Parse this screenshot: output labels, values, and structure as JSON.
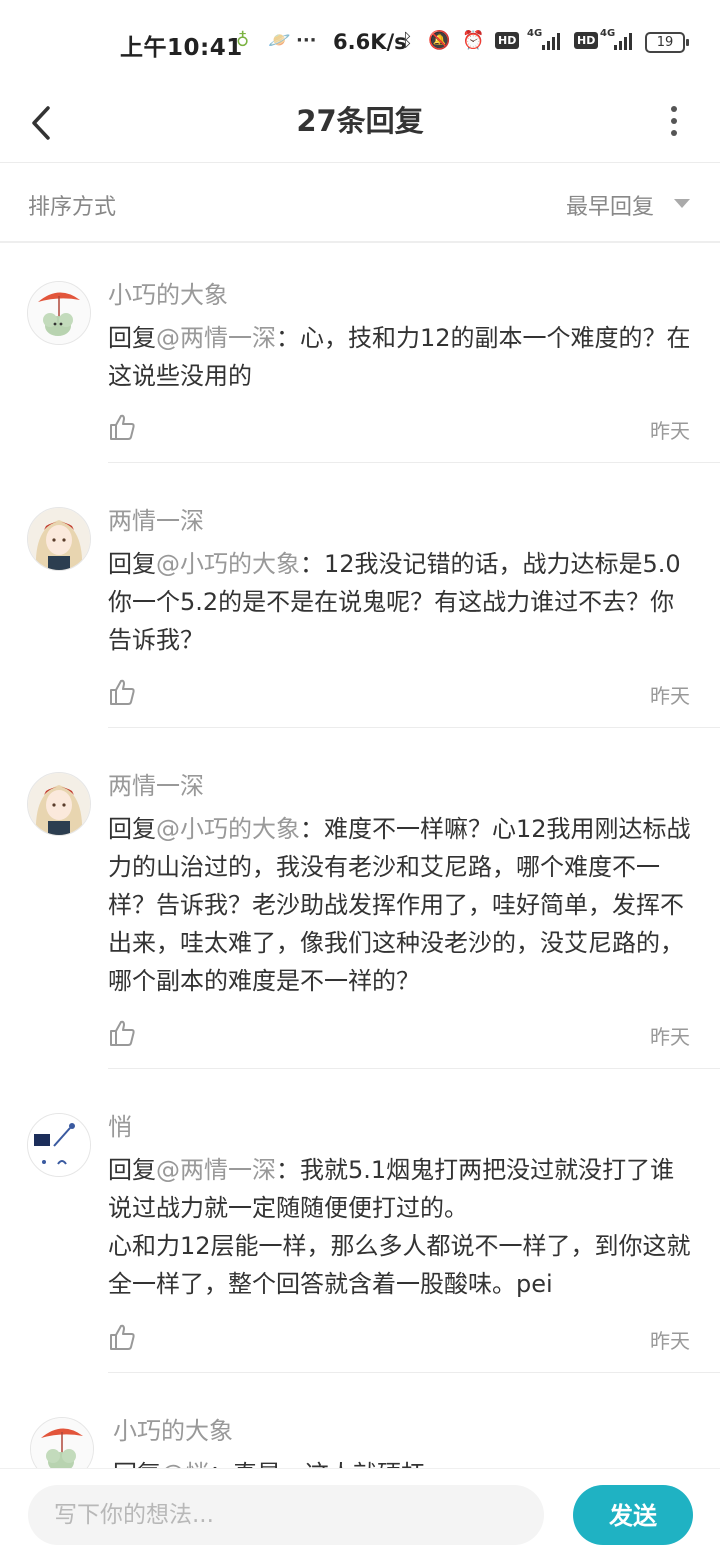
{
  "status_bar": {
    "time": "上午10:41",
    "dots": "···",
    "net_speed": "6.6K/s",
    "hd1": "HD",
    "g4_1": "4G",
    "hd2": "HD",
    "g4_2": "4G",
    "battery": "19"
  },
  "header": {
    "title": "27条回复"
  },
  "sort": {
    "label": "排序方式",
    "value": "最早回复"
  },
  "comments": [
    {
      "user": "小巧的大象",
      "prefix": "回复",
      "mention": "@两情一深",
      "text": "：心，技和力12的副本一个难度的？在这说些没用的",
      "date": "昨天"
    },
    {
      "user": "两情一深",
      "prefix": "回复",
      "mention": "@小巧的大象",
      "text": "：12我没记错的话，战力达标是5.0你一个5.2的是不是在说鬼呢？有这战力谁过不去？你告诉我？",
      "date": "昨天"
    },
    {
      "user": "两情一深",
      "prefix": "回复",
      "mention": "@小巧的大象",
      "text": "：难度不一样嘛？心12我用刚达标战力的山治过的，我没有老沙和艾尼路，哪个难度不一样？告诉我？老沙助战发挥作用了，哇好简单，发挥不出来，哇太难了，像我们这种没老沙的，没艾尼路的，哪个副本的难度是不一祥的？",
      "date": "昨天"
    },
    {
      "user": "悄",
      "prefix": "回复",
      "mention": "@两情一深",
      "text": "：我就5.1烟鬼打两把没过就没打了谁说过战力就一定随随便便打过的。",
      "text2": "心和力12层能一样，那么多人都说不一样了，到你这就全一样了，整个回答就含着一股酸味。pei",
      "date": "昨天"
    },
    {
      "user": "小巧的大象",
      "prefix": "回复",
      "mention": "@悄",
      "text": "：真是，这人就硬杠"
    }
  ],
  "input": {
    "placeholder": "写下你的想法...",
    "send_label": "发送"
  },
  "colors": {
    "accent": "#1fb2c3",
    "mention": "#999999"
  }
}
